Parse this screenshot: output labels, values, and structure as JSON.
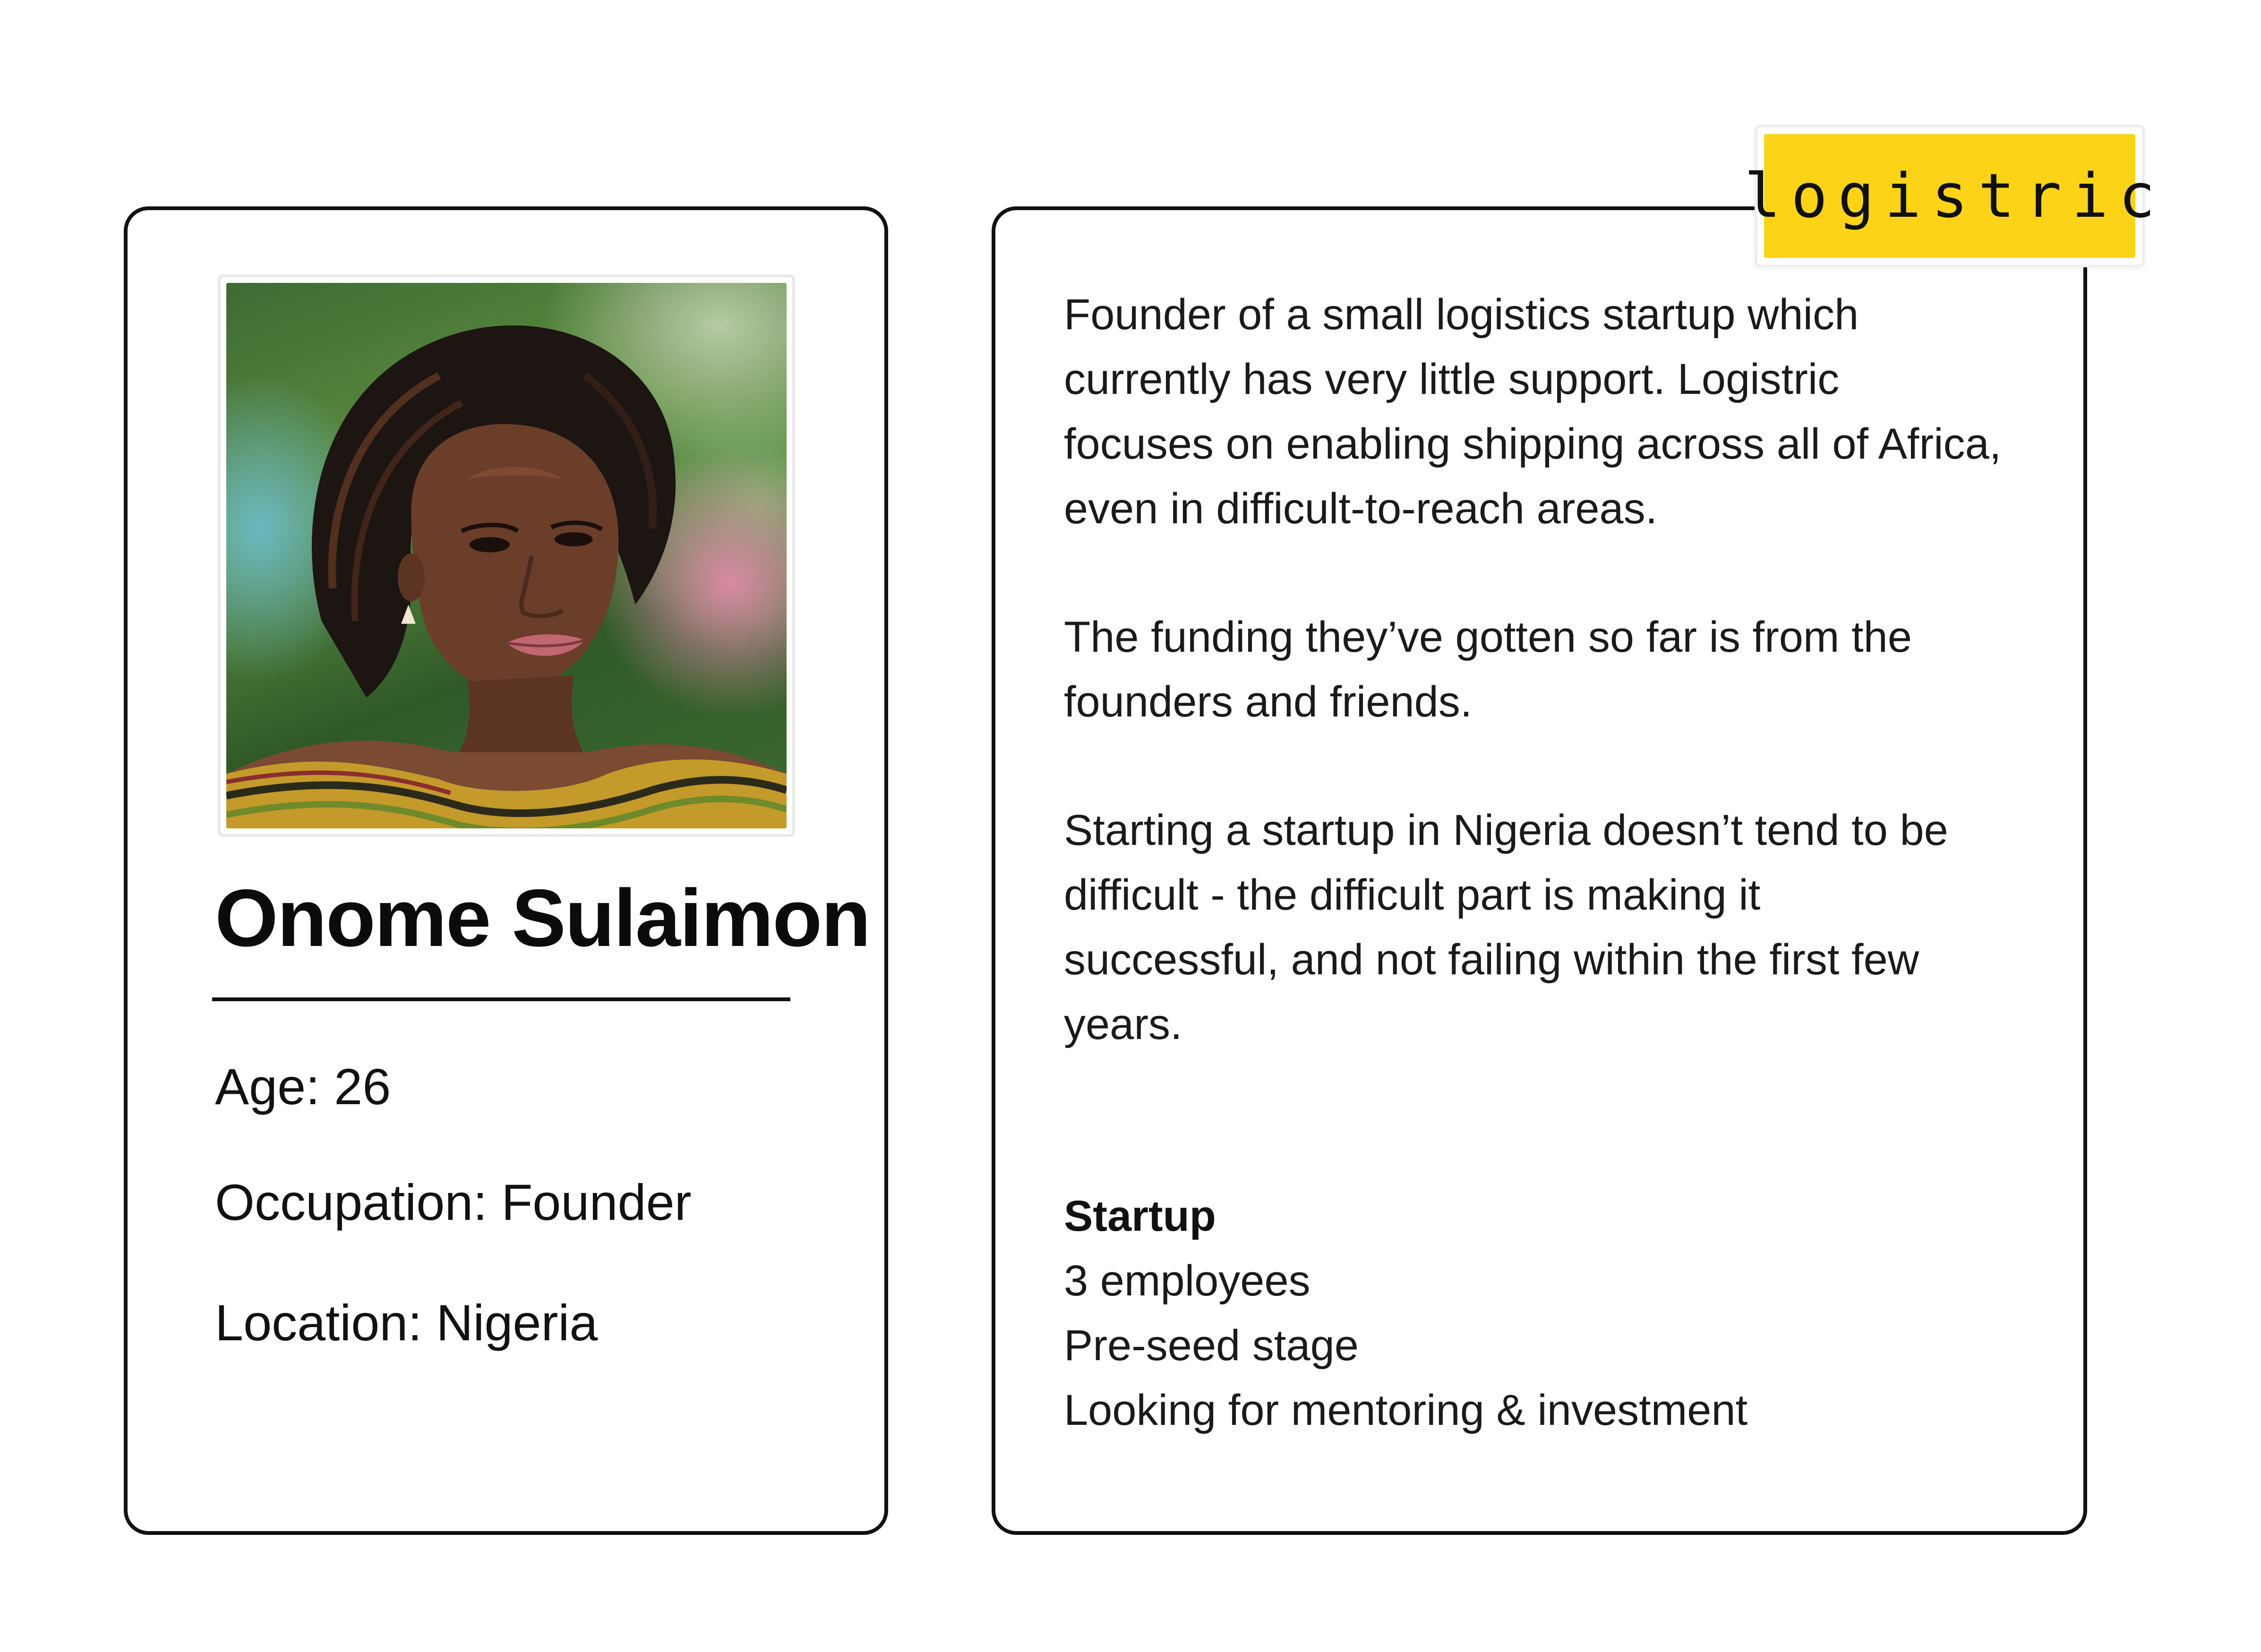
{
  "profile": {
    "name": "Onome Sulaimon",
    "age": "Age: 26",
    "occupation": "Occupation: Founder",
    "location": "Location: Nigeria"
  },
  "brand": {
    "wordmark": "logistric",
    "color": "#fcd316"
  },
  "story": {
    "paragraph1": [
      "Founder of a small logistics startup which",
      "currently has very little support. Logistric",
      "focuses on enabling shipping across all of Africa,",
      "even in difficult-to-reach areas."
    ],
    "paragraph2": [
      "The funding they’ve gotten so far is from the",
      "founders and friends."
    ],
    "paragraph3": [
      "Starting a startup in Nigeria doesn’t tend to be",
      "difficult - the difficult part is making it",
      "successful, and not failing within the first few",
      "years."
    ]
  },
  "startup": {
    "heading": "Startup",
    "details": [
      "3 employees",
      "Pre-seed stage",
      "Looking for mentoring & investment"
    ]
  }
}
